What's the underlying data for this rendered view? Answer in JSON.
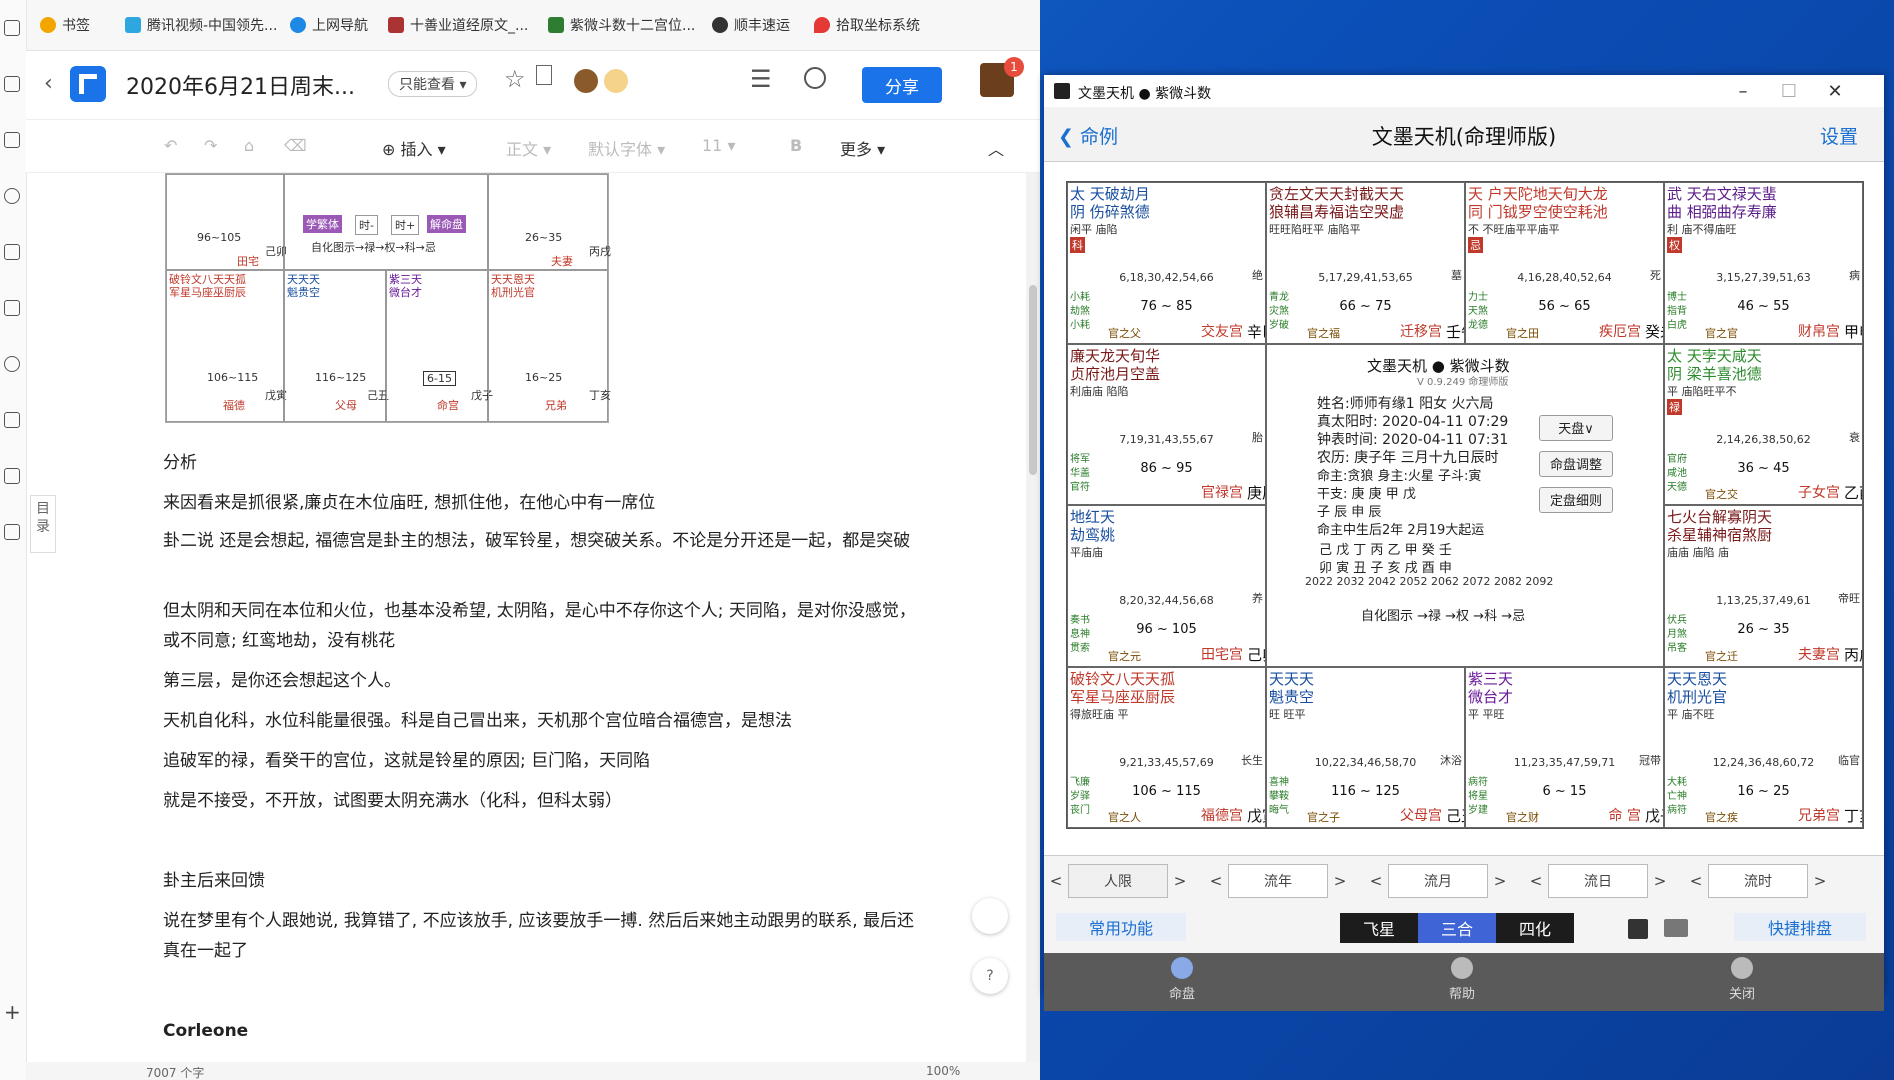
{
  "browser": {
    "bookmarks": [
      "书签",
      "腾讯视频-中国领先...",
      "上网导航",
      "十善业道经原文_...",
      "紫微斗数十二宫位...",
      "顺丰速运",
      "拾取坐标系统"
    ],
    "doc_title": "2020年6月21日周末...",
    "view_mode": "只能查看",
    "share_label": "分享",
    "notification_count": "1",
    "toolbar": {
      "insert": "插入",
      "style": "正文",
      "font": "默认字体",
      "size": "11",
      "bold": "B",
      "more": "更多"
    },
    "toc_label": "目录",
    "paragraphs": [
      "分析",
      "来因看来是抓很紧,廉贞在木位庙旺, 想抓住他，在他心中有一席位",
      "卦二说 还是会想起, 福德宫是卦主的想法，破军铃星，想突破关系。不论是分开还是一起，都是突破",
      "但太阴和天同在本位和火位，也基本没希望, 太阴陷，是心中不存你这个人; 天同陷，是对你没感觉，或不同意; 红鸾地劫，没有桃花",
      "第三层，是你还会想起这个人。",
      "天机自化科，水位科能量很强。科是自己冒出来，天机那个宫位暗合福德宫，是想法",
      "追破军的禄，看癸干的宫位，这就是铃星的原因; 巨门陷，天同陷",
      "就是不接受，不开放，试图要太阴充满水（化科，但科太弱）",
      "卦主后来回馈",
      "说在梦里有个人跟她说, 我算错了, 不应该放手, 应该要放手一搏. 然后后来她主动跟男的联系, 最后还真在一起了",
      "Corleone"
    ],
    "status": {
      "words": "7007 个字",
      "zoom": "100%"
    },
    "mini_chart": {
      "center_btns": [
        "学繁体",
        "时-",
        "时+",
        "解命盘"
      ],
      "sihua": "自化图示→禄→权→科→忌",
      "cells": [
        {
          "stars": "破铃文八天天孤\n军星马座巫厨辰",
          "range": "106~115",
          "name": "福德",
          "gz": "戊寅"
        },
        {
          "stars": "天天天\n魁贵空",
          "range": "116~125",
          "name": "父母",
          "gz": "己丑"
        },
        {
          "stars": "紫三天\n微台才",
          "range": "6-15",
          "name": "命宫",
          "gz": "戊子"
        },
        {
          "stars": "天天恩天\n机刑光官",
          "range": "16~25",
          "name": "兄弟",
          "gz": "丁亥"
        },
        {
          "stars": "",
          "range": "96~105",
          "name": "田宅",
          "gz": "己卯"
        },
        {
          "stars": "",
          "range": "26~35",
          "name": "夫妻",
          "gz": "丙戌"
        }
      ]
    }
  },
  "app": {
    "window_title": "文墨天机 ● 紫微斗数",
    "back_label": "命例",
    "title": "文墨天机(命理师版)",
    "settings_label": "设置",
    "palaces": [
      {
        "stars": "太 天破劫月\n阴 伤碎煞德",
        "sub": "闲平 庙陷",
        "hua": "科",
        "nums": "6,18,30,42,54,66",
        "range": "76 ~ 85",
        "left": "小耗\n劫煞\n小耗",
        "name": "交友宫",
        "small": "官之父",
        "gz": "辛巳",
        "stage": "绝"
      },
      {
        "stars": "贪左文天天封截天天\n狼辅昌寿福诰空哭虚",
        "sub": "旺旺陷旺平 庙陷平",
        "hua": "",
        "nums": "5,17,29,41,53,65",
        "range": "66 ~ 75",
        "left": "青龙\n灾煞\n岁破",
        "name": "迁移宫",
        "small": "官之福",
        "gz": "壬午",
        "stage": "墓"
      },
      {
        "stars": "天 户天陀地天旬大龙\n同 门钺罗空使空耗池",
        "sub": "不 不旺庙平平庙平",
        "hua": "忌",
        "nums": "4,16,28,40,52,64",
        "range": "56 ~ 65",
        "left": "力士\n天煞\n龙德",
        "name": "疾厄宫",
        "small": "官之田",
        "gz": "癸未",
        "stage": "死"
      },
      {
        "stars": "武 天右文禄天蜚\n曲 相弼曲存寿廉",
        "sub": "利 庙不得庙旺",
        "hua": "权",
        "nums": "3,15,27,39,51,63",
        "range": "46 ~ 55",
        "left": "博士\n指背\n白虎",
        "name": "财帛宫",
        "small": "官之官",
        "gz": "甲申",
        "stage": "病"
      },
      {
        "stars": "廉天龙天旬华\n贞府池月空盖",
        "sub": "利庙庙 陷陷",
        "hua": "",
        "nums": "7,19,31,43,55,67",
        "range": "86 ~ 95",
        "left": "将军\n华盖\n官符",
        "name": "官禄宫",
        "small": "",
        "gz": "庚辰",
        "stage": "胎"
      },
      {
        "stars": "太 天孛天咸天\n阴 梁羊喜池德",
        "sub": "平 庙陷旺平不",
        "hua": "禄",
        "nums": "2,14,26,38,50,62",
        "range": "36 ~ 45",
        "left": "官府\n咸池\n天德",
        "name": "子女宫",
        "small": "官之交",
        "gz": "乙酉",
        "stage": "衰"
      },
      {
        "stars": "地红天\n劫鸾姚",
        "sub": "平庙庙",
        "hua": "",
        "nums": "8,20,32,44,56,68",
        "range": "96 ~ 105",
        "left": "奏书\n息神\n贯索",
        "name": "田宅宫",
        "small": "官之元",
        "gz": "己卯",
        "stage": "养"
      },
      {
        "stars": "七火台解寡阴天\n杀星辅神宿煞厨",
        "sub": "庙庙 庙陷 庙",
        "hua": "",
        "nums": "1,13,25,37,49,61",
        "range": "26 ~ 35",
        "left": "伏兵\n月煞\n吊客",
        "name": "夫妻宫",
        "small": "官之迁",
        "gz": "丙戌",
        "stage": "帝旺"
      },
      {
        "stars": "破铃文八天天孤\n军星马座巫厨辰",
        "sub": "得旅旺庙 平",
        "hua": "",
        "nums": "9,21,33,45,57,69",
        "range": "106 ~ 115",
        "left": "飞廉\n岁驿\n丧门",
        "name": "福德宫",
        "small": "官之人",
        "gz": "戊寅",
        "stage": "长生"
      },
      {
        "stars": "天天天\n魁贵空",
        "sub": "旺 旺平",
        "hua": "",
        "nums": "10,22,34,46,58,70",
        "range": "116 ~ 125",
        "left": "喜神\n攀鞍\n晦气",
        "name": "父母宫",
        "small": "官之子",
        "gz": "己丑",
        "stage": "沐浴"
      },
      {
        "stars": "紫三天\n微台才",
        "sub": "平 平旺",
        "hua": "",
        "nums": "11,23,35,47,59,71",
        "range": "6 ~ 15",
        "left": "病符\n将星\n岁建",
        "name": "命 宫",
        "small": "官之财",
        "gz": "戊子",
        "stage": "冠带"
      },
      {
        "stars": "天天恩天\n机刑光官",
        "sub": "平 庙不旺",
        "hua": "",
        "nums": "12,24,36,48,60,72",
        "range": "16 ~ 25",
        "left": "大耗\n亡神\n病符",
        "name": "兄弟宫",
        "small": "官之疾",
        "gz": "丁亥",
        "stage": "临官"
      }
    ],
    "center": {
      "brand": "文墨天机 ● 紫微斗数",
      "version": "V 0.9.249 命理师版",
      "line1": "姓名:师师有缘1 阳女 火六局",
      "line2": "真太阳时: 2020-04-11 07:29",
      "line3": "钟表时间: 2020-04-11 07:31",
      "line4": "农历: 庚子年 三月十九日辰时",
      "line5": "命主:贪狼 身主:火星 子斗:寅",
      "line6": "干支: 庚  庚  甲  戊",
      "line7": "      子  辰  申  辰",
      "line8": "命主中生后2年 2月19大起运",
      "stems": "己  戊  丁  丙  乙  甲  癸  壬",
      "branches": "卯  寅  丑  子  亥  戌  酉  申",
      "years": "2022 2032 2042 2052 2062 2072 2082 2092",
      "sihua": "自化图示 →禄 →权 →科 →忌",
      "btn1": "天盘∨",
      "btn2": "命盘调整",
      "btn3": "定盘细则"
    },
    "nav": {
      "ren": "人限",
      "liunian": "流年",
      "liuyue": "流月",
      "liuri": "流日",
      "liushi": "流时"
    },
    "func": {
      "common": "常用功能",
      "feixing": "飞星",
      "sanhe": "三合",
      "sihua": "四化",
      "quick": "快捷排盘"
    },
    "bottom": {
      "mingli": "命盘",
      "help": "帮助",
      "close": "关闭"
    },
    "colors": {
      "accent": "#1a6fd1",
      "segment_active": "#3e64d6",
      "segment_dark": "#1c1c1c"
    }
  }
}
